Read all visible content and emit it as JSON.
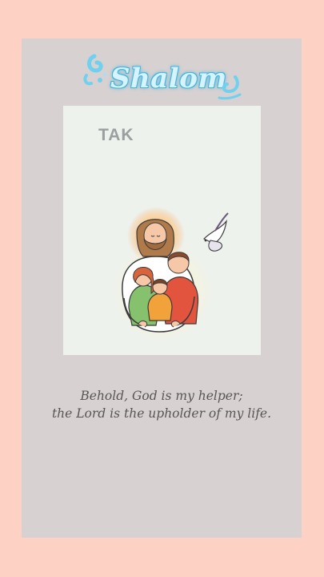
{
  "header": {
    "title": "Shalom"
  },
  "image": {
    "watermark": "TAK"
  },
  "verse": {
    "line1": "Behold, God is my helper;",
    "line2": "the Lord is the upholder of my life."
  },
  "colors": {
    "page_background": "#fdd1c4",
    "card_background": "#d8d1d1",
    "title_glow": "#4fb7dd",
    "verse_text": "#575555"
  },
  "icons": [
    "water-swirl-icon",
    "dove-icon"
  ]
}
